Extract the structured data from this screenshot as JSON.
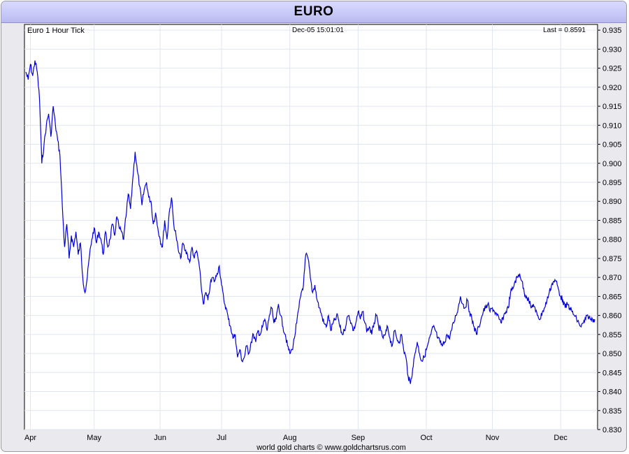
{
  "window": {
    "title": "EURO"
  },
  "chart_data": {
    "type": "line",
    "title": "EURO",
    "subtitle": "Euro 1 Hour Tick",
    "timestamp": "Dec-05  15:01:01",
    "last_label": "Last = 0.8591",
    "footer": "world gold charts © www.goldchartsrus.com",
    "x_tick_labels": [
      "Apr",
      "May",
      "Jun",
      "Jul",
      "Aug",
      "Sep",
      "Oct",
      "Nov",
      "Dec"
    ],
    "y_tick_labels": [
      "0.935",
      "0.930",
      "0.925",
      "0.920",
      "0.915",
      "0.910",
      "0.905",
      "0.900",
      "0.895",
      "0.890",
      "0.885",
      "0.880",
      "0.875",
      "0.870",
      "0.865",
      "0.860",
      "0.855",
      "0.850",
      "0.845",
      "0.840",
      "0.835",
      "0.830"
    ],
    "ylim": [
      0.83,
      0.9365
    ],
    "grid": true,
    "line_color": "#0000dd",
    "series": [
      {
        "x": [
          0,
          1,
          2,
          3,
          4,
          5,
          6,
          7,
          8,
          9,
          10,
          11,
          12,
          13,
          14,
          15,
          16,
          17,
          18,
          19,
          20,
          21,
          22,
          23,
          24,
          25,
          26,
          27,
          28,
          29,
          30,
          31,
          32,
          33,
          34,
          35,
          36,
          37,
          38,
          39,
          40,
          41,
          42,
          43,
          44,
          45,
          46,
          47,
          48,
          49,
          50,
          51,
          52,
          53,
          54,
          55,
          56,
          57,
          58,
          59,
          60,
          61,
          62,
          63,
          64,
          65,
          66,
          67,
          68,
          69,
          70,
          71,
          72,
          73,
          74,
          75,
          76,
          77,
          78,
          79,
          80,
          81,
          82,
          83,
          84,
          85,
          86,
          87,
          88,
          89,
          90,
          91,
          92,
          93,
          94,
          95,
          96,
          97,
          98,
          99,
          100,
          101,
          102,
          103,
          104,
          105,
          106,
          107,
          108,
          109,
          110,
          111,
          112,
          113,
          114,
          115,
          116,
          117,
          118,
          119,
          120,
          121,
          122,
          123,
          124,
          125,
          126,
          127,
          128,
          129,
          130,
          131,
          132,
          133,
          134,
          135,
          136,
          137,
          138,
          139,
          140,
          141,
          142,
          143,
          144,
          145,
          146,
          147,
          148,
          149,
          150,
          151,
          152,
          153,
          154,
          155,
          156,
          157,
          158,
          159,
          160,
          161,
          162,
          163,
          164,
          165,
          166,
          167,
          168,
          169,
          170,
          171,
          172,
          173,
          174,
          175,
          176,
          177,
          178,
          179,
          180,
          181,
          182,
          183,
          184,
          185,
          186,
          187,
          188,
          189,
          190,
          191,
          192,
          193,
          194,
          195,
          196,
          197,
          198,
          199,
          200,
          201,
          202,
          203,
          204,
          205,
          206,
          207,
          208,
          209,
          210,
          211,
          212,
          213,
          214,
          215,
          216,
          217,
          218,
          219,
          220,
          221,
          222,
          223,
          224,
          225,
          226,
          227,
          228,
          229,
          230,
          231,
          232,
          233,
          234,
          235,
          236,
          237,
          238,
          239,
          240,
          241,
          242,
          243,
          244,
          245,
          246,
          247,
          248,
          249,
          250
        ],
        "y": [
          0.924,
          0.922,
          0.926,
          0.923,
          0.927,
          0.924,
          0.917,
          0.9,
          0.905,
          0.91,
          0.913,
          0.907,
          0.915,
          0.91,
          0.906,
          0.902,
          0.889,
          0.878,
          0.884,
          0.875,
          0.881,
          0.878,
          0.882,
          0.876,
          0.879,
          0.87,
          0.866,
          0.87,
          0.876,
          0.88,
          0.883,
          0.879,
          0.882,
          0.88,
          0.876,
          0.882,
          0.878,
          0.88,
          0.884,
          0.881,
          0.886,
          0.883,
          0.882,
          0.88,
          0.886,
          0.892,
          0.888,
          0.896,
          0.903,
          0.898,
          0.894,
          0.889,
          0.893,
          0.895,
          0.891,
          0.89,
          0.884,
          0.887,
          0.883,
          0.88,
          0.878,
          0.885,
          0.88,
          0.887,
          0.891,
          0.884,
          0.881,
          0.877,
          0.875,
          0.879,
          0.877,
          0.876,
          0.874,
          0.878,
          0.875,
          0.877,
          0.874,
          0.868,
          0.863,
          0.866,
          0.864,
          0.868,
          0.87,
          0.869,
          0.871,
          0.873,
          0.868,
          0.864,
          0.862,
          0.859,
          0.857,
          0.854,
          0.855,
          0.849,
          0.851,
          0.848,
          0.849,
          0.852,
          0.85,
          0.853,
          0.855,
          0.853,
          0.856,
          0.855,
          0.857,
          0.859,
          0.856,
          0.86,
          0.862,
          0.858,
          0.859,
          0.863,
          0.86,
          0.857,
          0.855,
          0.852,
          0.85,
          0.851,
          0.854,
          0.858,
          0.862,
          0.866,
          0.868,
          0.876,
          0.875,
          0.87,
          0.866,
          0.868,
          0.864,
          0.862,
          0.86,
          0.858,
          0.857,
          0.86,
          0.856,
          0.858,
          0.859,
          0.86,
          0.857,
          0.855,
          0.856,
          0.859,
          0.86,
          0.858,
          0.856,
          0.858,
          0.861,
          0.859,
          0.861,
          0.858,
          0.856,
          0.857,
          0.855,
          0.858,
          0.86,
          0.857,
          0.856,
          0.854,
          0.855,
          0.857,
          0.854,
          0.852,
          0.856,
          0.854,
          0.853,
          0.855,
          0.851,
          0.849,
          0.844,
          0.842,
          0.846,
          0.85,
          0.853,
          0.85,
          0.848,
          0.849,
          0.851,
          0.853,
          0.855,
          0.857,
          0.856,
          0.854,
          0.853,
          0.852,
          0.853,
          0.855,
          0.854,
          0.856,
          0.858,
          0.86,
          0.862,
          0.865,
          0.863,
          0.862,
          0.864,
          0.861,
          0.859,
          0.857,
          0.855,
          0.857,
          0.859,
          0.861,
          0.862,
          0.863,
          0.861,
          0.862,
          0.861,
          0.86,
          0.859,
          0.858,
          0.86,
          0.861,
          0.862,
          0.866,
          0.867,
          0.869,
          0.87,
          0.871,
          0.869,
          0.866,
          0.865,
          0.864,
          0.862,
          0.863,
          0.861,
          0.86,
          0.859,
          0.861,
          0.862,
          0.864,
          0.866,
          0.868,
          0.869,
          0.869,
          0.867,
          0.865,
          0.864,
          0.862,
          0.863,
          0.862,
          0.861,
          0.86,
          0.859,
          0.858,
          0.857,
          0.858,
          0.859,
          0.86,
          0.859,
          0.859,
          0.859
        ],
        "color": "#0000dd"
      }
    ]
  }
}
